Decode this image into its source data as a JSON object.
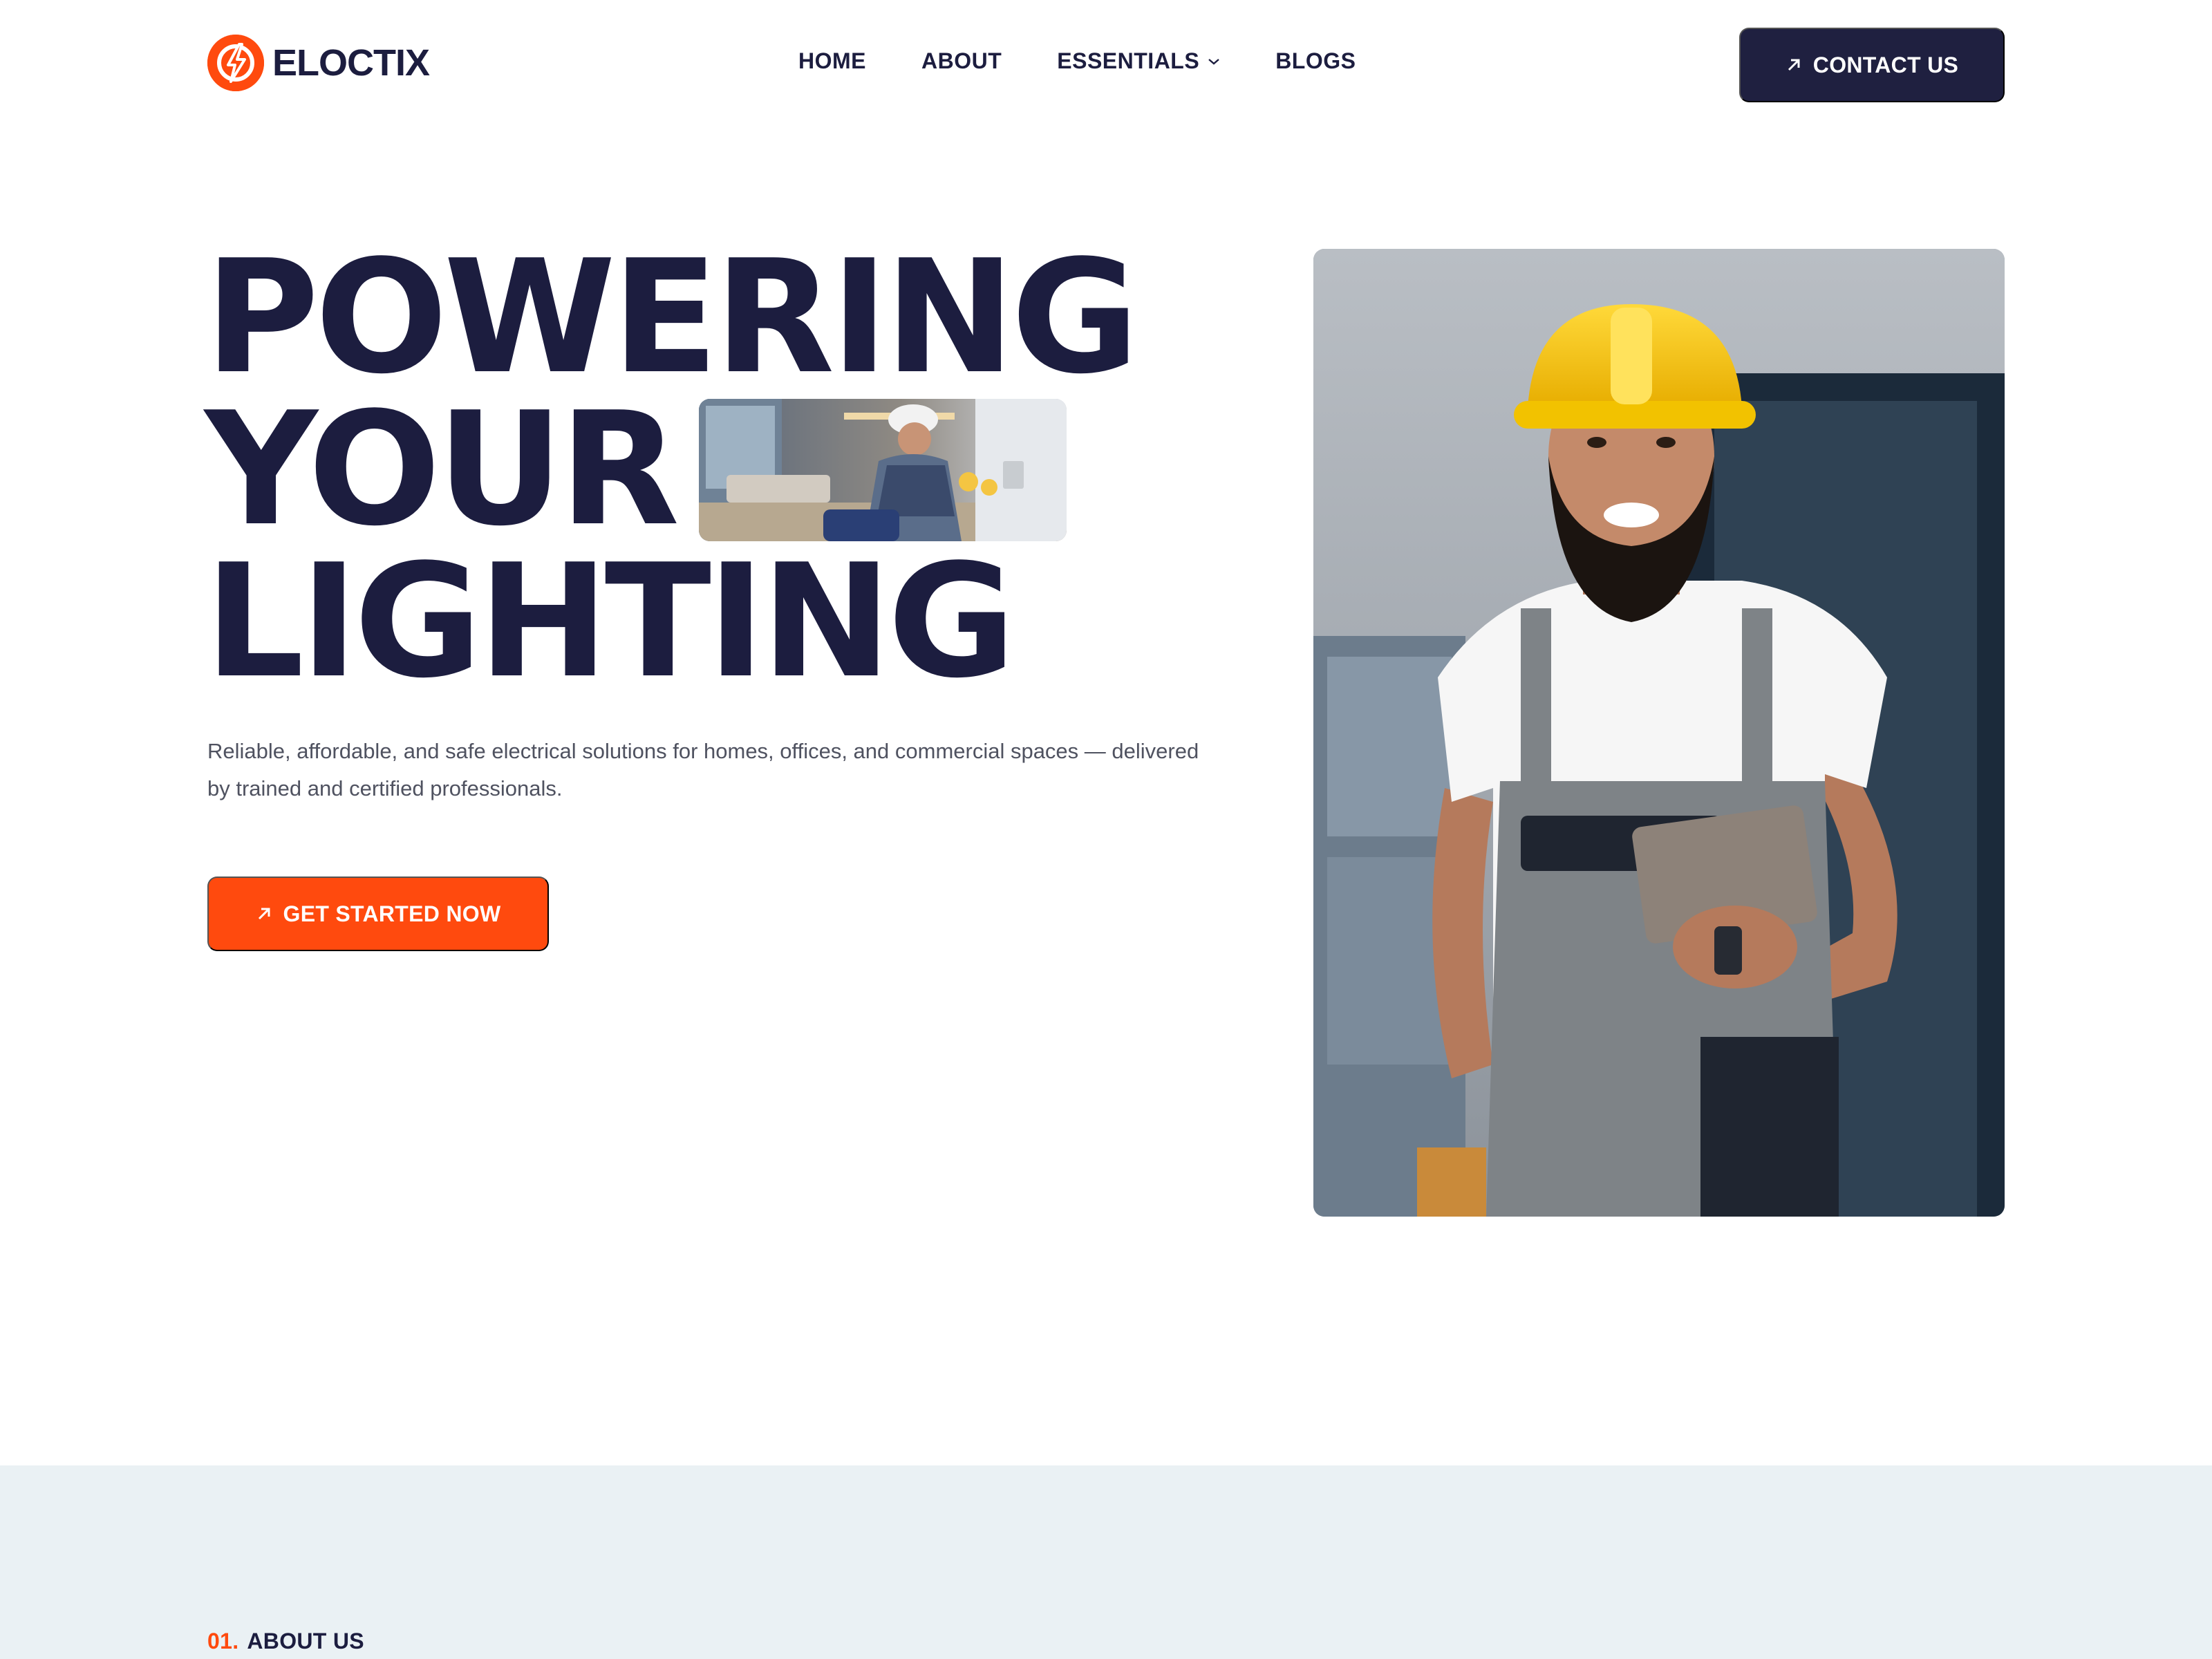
{
  "brand": {
    "name": "ELOCTIX",
    "accent": "#ff4a0e",
    "dark": "#1c1d3f"
  },
  "nav": {
    "items": [
      {
        "label": "HOME"
      },
      {
        "label": "ABOUT"
      },
      {
        "label": "ESSENTIALS",
        "has_dropdown": true
      },
      {
        "label": "BLOGS"
      }
    ],
    "contact_label": "CONTACT US"
  },
  "hero": {
    "line1": "POWERING",
    "line2": "YOUR",
    "line3": "LIGHTING",
    "subtitle": "Reliable, affordable, and safe electrical solutions for homes, offices, and commercial spaces — delivered by trained and certified professionals.",
    "cta_label": "GET STARTED NOW"
  },
  "about": {
    "number": "01.",
    "label": "ABOUT US"
  },
  "icons": {
    "logo": "lightning-bolt-circle-icon",
    "button_arrow": "arrow-up-right-icon",
    "dropdown": "chevron-down-icon"
  }
}
